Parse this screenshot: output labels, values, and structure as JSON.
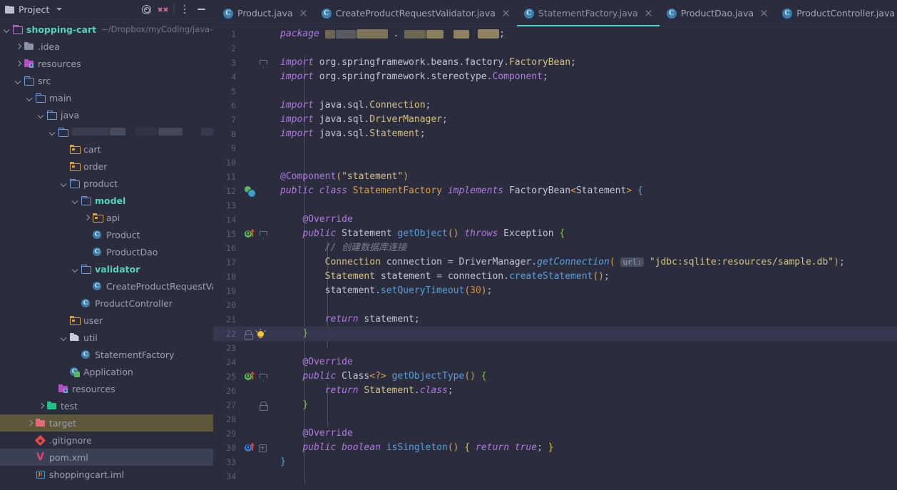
{
  "sidebar": {
    "panel_title": "Project",
    "icons": {
      "locate": "target-icon",
      "collapse": "collapse-all-icon",
      "options": "more-options-icon",
      "hide": "minimize-icon"
    },
    "project_name": "shopping-cart",
    "project_path": "~/Dropbox/myCoding/java-tra",
    "items": [
      {
        "label": ".idea",
        "indent": 1,
        "icon": "folder-module",
        "arrow": "right",
        "state": "none"
      },
      {
        "label": "resources",
        "indent": 1,
        "icon": "folder-resource",
        "arrow": "right",
        "state": "none"
      },
      {
        "label": "src",
        "indent": 1,
        "icon": "folder-outline",
        "arrow": "down",
        "state": "none"
      },
      {
        "label": "main",
        "indent": 2,
        "icon": "folder-outline",
        "arrow": "down",
        "state": "none"
      },
      {
        "label": "java",
        "indent": 3,
        "icon": "folder-outline",
        "arrow": "down",
        "state": "none"
      },
      {
        "label": "",
        "indent": 4,
        "icon": "folder-outline",
        "arrow": "down",
        "state": "redacted"
      },
      {
        "label": "cart",
        "indent": 5,
        "icon": "folder-source",
        "arrow": "none",
        "state": "none"
      },
      {
        "label": "order",
        "indent": 5,
        "icon": "folder-source",
        "arrow": "none",
        "state": "none"
      },
      {
        "label": "product",
        "indent": 5,
        "icon": "folder-outline",
        "arrow": "down",
        "state": "none"
      },
      {
        "label": "model",
        "indent": 6,
        "icon": "folder-outline",
        "arrow": "down",
        "state": "bold"
      },
      {
        "label": "api",
        "indent": 7,
        "icon": "folder-source",
        "arrow": "right",
        "state": "none"
      },
      {
        "label": "Product",
        "indent": 7,
        "icon": "java-class",
        "arrow": "none",
        "state": "none"
      },
      {
        "label": "ProductDao",
        "indent": 7,
        "icon": "java-class",
        "arrow": "none",
        "state": "none"
      },
      {
        "label": "validator",
        "indent": 6,
        "icon": "folder-outline",
        "arrow": "down",
        "state": "bold"
      },
      {
        "label": "CreateProductRequestValida",
        "indent": 7,
        "icon": "java-class",
        "arrow": "none",
        "state": "none"
      },
      {
        "label": "ProductController",
        "indent": 6,
        "icon": "java-class",
        "arrow": "none",
        "state": "none"
      },
      {
        "label": "user",
        "indent": 5,
        "icon": "folder-source",
        "arrow": "none",
        "state": "none"
      },
      {
        "label": "util",
        "indent": 5,
        "icon": "folder-util",
        "arrow": "down",
        "state": "none"
      },
      {
        "label": "StatementFactory",
        "indent": 6,
        "icon": "java-class",
        "arrow": "none",
        "state": "none"
      },
      {
        "label": "Application",
        "indent": 5,
        "icon": "java-app-class",
        "arrow": "none",
        "state": "none"
      },
      {
        "label": "resources",
        "indent": 4,
        "icon": "folder-resource",
        "arrow": "none",
        "state": "none"
      },
      {
        "label": "test",
        "indent": 3,
        "icon": "folder-test",
        "arrow": "right",
        "state": "none"
      },
      {
        "label": "target",
        "indent": 2,
        "icon": "folder-target",
        "arrow": "right",
        "state": "highlight-olive"
      },
      {
        "label": ".gitignore",
        "indent": 2,
        "icon": "gitignore-file",
        "arrow": "none",
        "state": "none"
      },
      {
        "label": "pom.xml",
        "indent": 2,
        "icon": "maven-file",
        "arrow": "none",
        "state": "selected"
      },
      {
        "label": "shoppingcart.iml",
        "indent": 2,
        "icon": "iml-file",
        "arrow": "none",
        "state": "none"
      }
    ]
  },
  "tabs": [
    {
      "label": "Product.java",
      "active": false
    },
    {
      "label": "CreateProductRequestValidator.java",
      "active": false
    },
    {
      "label": "StatementFactory.java",
      "active": true
    },
    {
      "label": "ProductDao.java",
      "active": false
    },
    {
      "label": "ProductController.java",
      "active": false
    }
  ],
  "editor": {
    "current_line": 22,
    "line_numbers": [
      1,
      2,
      3,
      4,
      5,
      6,
      7,
      8,
      9,
      10,
      11,
      12,
      13,
      14,
      15,
      16,
      17,
      18,
      19,
      20,
      21,
      22,
      23,
      24,
      25,
      26,
      27,
      28,
      29,
      30,
      33,
      34
    ],
    "gutter_icons": [
      {
        "line": 12,
        "icon": "spring-bean-icon"
      },
      {
        "line": 15,
        "icon": "override-method-green-icon"
      },
      {
        "line": 22,
        "icon": "intention-bulb-icon"
      },
      {
        "line": 25,
        "icon": "override-method-green-icon"
      },
      {
        "line": 30,
        "icon": "override-method-blue-icon"
      }
    ],
    "code_lines": [
      {
        "n": 1,
        "text": "package <redacted>.<redacted>.<redacted>;"
      },
      {
        "n": 2,
        "text": ""
      },
      {
        "n": 3,
        "text": "import org.springframework.beans.factory.FactoryBean;"
      },
      {
        "n": 4,
        "text": "import org.springframework.stereotype.Component;"
      },
      {
        "n": 5,
        "text": ""
      },
      {
        "n": 6,
        "text": "import java.sql.Connection;"
      },
      {
        "n": 7,
        "text": "import java.sql.DriverManager;"
      },
      {
        "n": 8,
        "text": "import java.sql.Statement;"
      },
      {
        "n": 9,
        "text": ""
      },
      {
        "n": 10,
        "text": ""
      },
      {
        "n": 11,
        "text": "@Component(\"statement\")"
      },
      {
        "n": 12,
        "text": "public class StatementFactory implements FactoryBean<Statement> {"
      },
      {
        "n": 13,
        "text": ""
      },
      {
        "n": 14,
        "text": "    @Override"
      },
      {
        "n": 15,
        "text": "    public Statement getObject() throws Exception {"
      },
      {
        "n": 16,
        "text": "        // 创建数据库连接"
      },
      {
        "n": 17,
        "text": "        Connection connection = DriverManager.getConnection( url: \"jdbc:sqlite:resources/sample.db\");"
      },
      {
        "n": 18,
        "text": "        Statement statement = connection.createStatement();"
      },
      {
        "n": 19,
        "text": "        statement.setQueryTimeout(30);"
      },
      {
        "n": 20,
        "text": ""
      },
      {
        "n": 21,
        "text": "        return statement;"
      },
      {
        "n": 22,
        "text": "    }"
      },
      {
        "n": 23,
        "text": ""
      },
      {
        "n": 24,
        "text": "    @Override"
      },
      {
        "n": 25,
        "text": "    public Class<?> getObjectType() {"
      },
      {
        "n": 26,
        "text": "        return Statement.class;"
      },
      {
        "n": 27,
        "text": "    }"
      },
      {
        "n": 28,
        "text": ""
      },
      {
        "n": 29,
        "text": "    @Override"
      },
      {
        "n": 30,
        "text": "    public boolean isSingleton() { return true; }"
      },
      {
        "n": 33,
        "text": "}"
      },
      {
        "n": 34,
        "text": ""
      }
    ],
    "parameter_hint": "url:",
    "comment_text": "// 创建数据库连接",
    "connection_string": "\"jdbc:sqlite:resources/sample.db\""
  },
  "colors": {
    "background": "#2b2d3e",
    "accent_tab_underline": "#4fd0cf",
    "current_line": "#34374f",
    "selection_olive": "#5d563a",
    "selection_blue": "#3c4057",
    "keyword": "#b07ae0",
    "string": "#d4c185",
    "class_name": "#d8a24a",
    "method": "#5a9fd8",
    "number": "#d88a3a",
    "comment": "#7a8094"
  }
}
